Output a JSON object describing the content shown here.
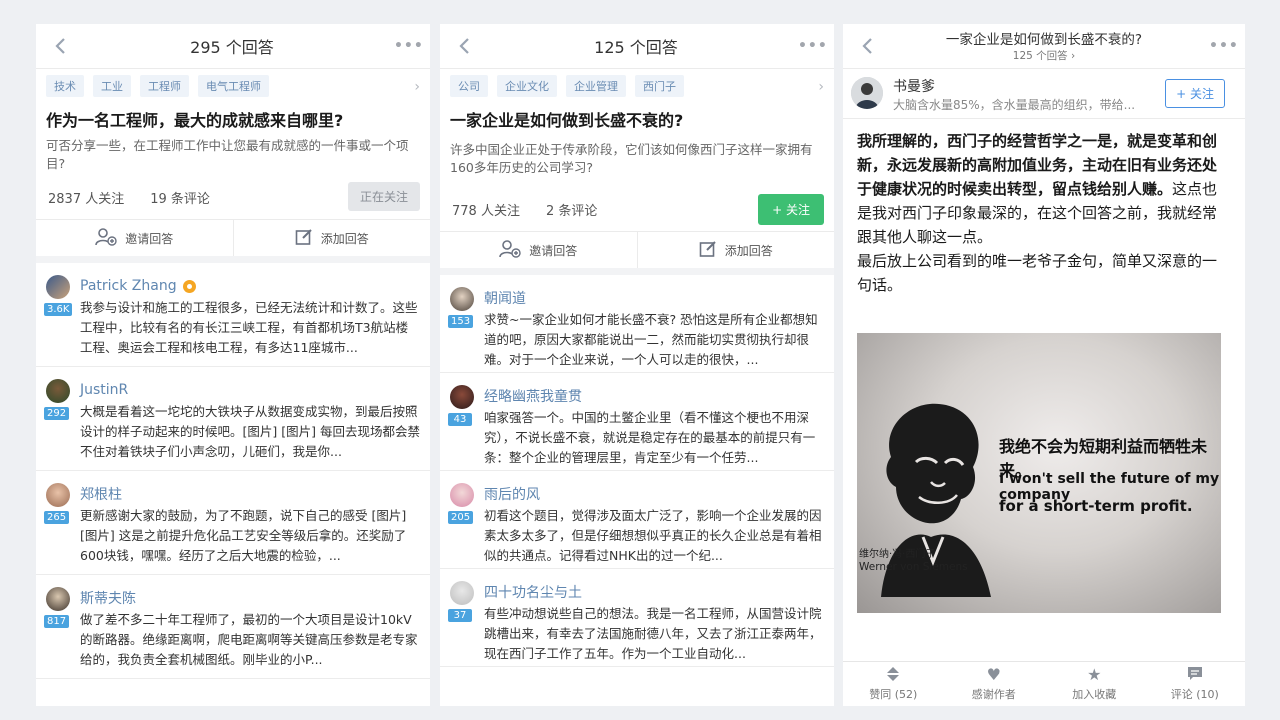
{
  "screen1": {
    "header_title": "295 个回答",
    "tags": [
      "技术",
      "工业",
      "工程师",
      "电气工程师"
    ],
    "question_title": "作为一名工程师，最大的成就感来自哪里?",
    "question_desc": "可否分享一些，在工程师工作中让您最有成就感的一件事或一个项目?",
    "followers": "2837 人关注",
    "comments": "19 条评论",
    "follow_state": "正在关注",
    "invite_label": "邀请回答",
    "add_answer_label": "添加回答",
    "answers": [
      {
        "author": "Patrick Zhang",
        "votes": "3.6K",
        "excerpt": "我参与设计和施工的工程很多，已经无法统计和计数了。这些工程中，比较有名的有长江三峡工程，有首都机场T3航站楼工程、奥运会工程和核电工程，有多达11座城市..."
      },
      {
        "author": "JustinR",
        "votes": "292",
        "excerpt": "大概是看着这一坨坨的大铁块子从数据变成实物，到最后按照设计的样子动起来的时候吧。[图片] [图片] 每回去现场都会禁不住对着铁块子们小声念叨，儿砸们，我是你..."
      },
      {
        "author": "郑根柱",
        "votes": "265",
        "excerpt": "更新感谢大家的鼓励，为了不跑题，说下自己的感受 [图片] [图片] 这是之前提升危化品工艺安全等级后拿的。还奖励了600块钱，嘿嘿。经历了之后大地震的检验，..."
      },
      {
        "author": "斯蒂夫陈",
        "votes": "817",
        "excerpt": "做了差不多二十年工程师了，最初的一个大项目是设计10kV的断路器。绝缘距离啊，爬电距离啊等关键高压参数是老专家给的，我负责全套机械图纸。刚毕业的小P..."
      }
    ]
  },
  "screen2": {
    "header_title": "125 个回答",
    "tags": [
      "公司",
      "企业文化",
      "企业管理",
      "西门子"
    ],
    "question_title": "一家企业是如何做到长盛不衰的?",
    "question_desc": "许多中国企业正处于传承阶段，它们该如何像西门子这样一家拥有160多年历史的公司学习?",
    "followers": "778 人关注",
    "comments": "2 条评论",
    "follow_label": "+ 关注",
    "invite_label": "邀请回答",
    "add_answer_label": "添加回答",
    "answers": [
      {
        "author": "朝闻道",
        "votes": "153",
        "excerpt": "求赞~一家企业如何才能长盛不衰? 恐怕这是所有企业都想知道的吧，原因大家都能说出一二，然而能切实贯彻执行却很难。对于一个企业来说，一个人可以走的很快，..."
      },
      {
        "author": "经略幽燕我童贯",
        "votes": "43",
        "excerpt": "咱家强答一个。中国的土鳖企业里（看不懂这个梗也不用深究），不说长盛不衰，就说是稳定存在的最基本的前提只有一条：整个企业的管理层里，肯定至少有一个任劳..."
      },
      {
        "author": "雨后的风",
        "votes": "205",
        "excerpt": "初看这个题目，觉得涉及面太广泛了，影响一个企业发展的因素太多太多了，但是仔细想想似乎真正的长久企业总是有着相似的共通点。记得看过NHK出的过一个纪..."
      },
      {
        "author": "四十功名尘与土",
        "votes": "37",
        "excerpt": "有些冲动想说些自己的想法。我是一名工程师，从国营设计院跳槽出来，有幸去了法国施耐德八年，又去了浙江正泰两年，现在西门子工作了五年。作为一个工业自动化..."
      }
    ]
  },
  "screen3": {
    "header_title": "一家企业是如何做到长盛不衰的?",
    "header_sub": "125 个回答 ›",
    "author_name": "书曼爹",
    "author_bio": "大脑含水量85%，含水量最高的组织，带给...",
    "follow_label": "+ 关注",
    "body_bold": "我所理解的，西门子的经营哲学之一是，就是变革和创新，永远发展新的高附加值业务，主动在旧有业务还处于健康状况的时候卖出转型，留点钱给别人赚。",
    "body_rest": "这点也是我对西门子印象最深的，在这个回答之前，我就经常跟其他人聊这一点。",
    "body_para2": "最后放上公司看到的唯一老爷子金句，简单又深意的一句话。",
    "photo_cn": "我绝不会为短期利益而牺牲未来。",
    "photo_en1": "I won't sell the future of my company",
    "photo_en2": "for a short-term profit.",
    "photo_caption_cn": "维尔纳·冯·西门子",
    "photo_caption_en": "Werner von Siemens",
    "tabs": [
      {
        "label": "赞同 (52)",
        "icon": "thumb-up-icon"
      },
      {
        "label": "感谢作者",
        "icon": "heart-icon"
      },
      {
        "label": "加入收藏",
        "icon": "star-icon"
      },
      {
        "label": "评论 (10)",
        "icon": "comment-icon"
      }
    ]
  }
}
